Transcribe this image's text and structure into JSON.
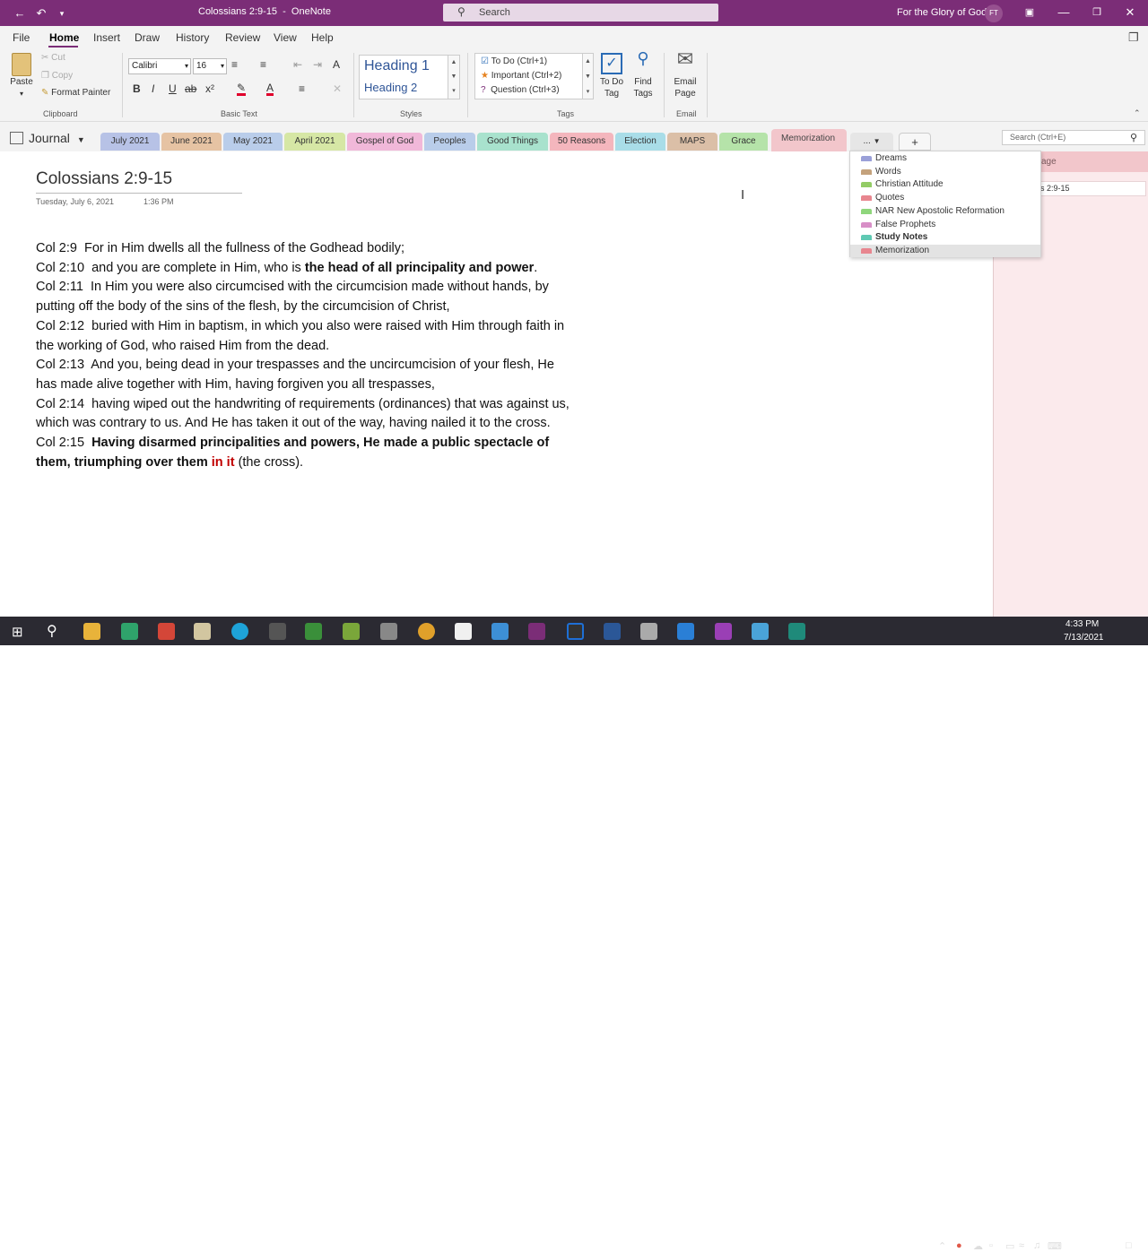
{
  "window": {
    "title": "Colossians 2:9-15  -  OneNote",
    "search_placeholder": "Search",
    "account_name": "For the Glory of God",
    "avatar_initials": "FT",
    "accent_color": "#7b2d77"
  },
  "menu": {
    "items": [
      "File",
      "Home",
      "Insert",
      "Draw",
      "History",
      "Review",
      "View",
      "Help"
    ],
    "active": "Home"
  },
  "ribbon": {
    "clipboard": {
      "paste": "Paste",
      "cut": "Cut",
      "copy": "Copy",
      "format_painter": "Format Painter",
      "label": "Clipboard"
    },
    "basic_text": {
      "font": "Calibri",
      "size": "16",
      "label": "Basic Text"
    },
    "styles": {
      "heading1": "Heading 1",
      "heading2": "Heading 2",
      "label": "Styles"
    },
    "tags": {
      "todo": "To Do (Ctrl+1)",
      "important": "Important (Ctrl+2)",
      "question": "Question (Ctrl+3)",
      "todo_tag": "To Do Tag",
      "find_tags": "Find Tags",
      "label": "Tags"
    },
    "email": {
      "email_page": "Email Page",
      "label": "Email"
    }
  },
  "notebook": {
    "name": "Journal"
  },
  "sections": [
    {
      "name": "July 2021",
      "color": "#b7c2e6"
    },
    {
      "name": "June 2021",
      "color": "#e6c3a3"
    },
    {
      "name": "May 2021",
      "color": "#b9cdea"
    },
    {
      "name": "April 2021",
      "color": "#d6e7a5"
    },
    {
      "name": "Gospel of God",
      "color": "#f1b8d9"
    },
    {
      "name": "Peoples",
      "color": "#b9cdea"
    },
    {
      "name": "Good Things",
      "color": "#a8e2cd"
    },
    {
      "name": "50 Reasons",
      "color": "#f4b6bd"
    },
    {
      "name": "Election",
      "color": "#a9dde8"
    },
    {
      "name": "MAPS",
      "color": "#dbbfa7"
    },
    {
      "name": "Grace",
      "color": "#b5e3a9"
    },
    {
      "name": "Memorization",
      "color": "#f2c6cb"
    }
  ],
  "more_sections_label": "...",
  "tab_search_placeholder": "Search (Ctrl+E)",
  "overflow_sections": [
    {
      "name": "Dreams",
      "color": "#9aa0d8"
    },
    {
      "name": "Words",
      "color": "#c4a27c"
    },
    {
      "name": "Christian Attitude",
      "color": "#93cc66"
    },
    {
      "name": "Quotes",
      "color": "#e8868f"
    },
    {
      "name": "NAR New Apostolic Reformation",
      "color": "#8fd67c"
    },
    {
      "name": "False Prophets",
      "color": "#d88fc7"
    },
    {
      "name": "Study Notes",
      "color": "#5fc9b3",
      "bold": true
    },
    {
      "name": "Memorization",
      "color": "#e8868f",
      "highlighted": true
    }
  ],
  "page": {
    "title": "Colossians 2:9-15",
    "date": "Tuesday, July 6, 2021",
    "time": "1:36 PM",
    "verses": [
      {
        "parts": [
          {
            "text": "Col 2:9  For in Him dwells all the fullness of the Godhead bodily;"
          }
        ]
      },
      {
        "parts": [
          {
            "text": "Col 2:10  and you are complete in Him, who is "
          },
          {
            "text": "the head of all principality and power",
            "bold": true
          },
          {
            "text": "."
          }
        ]
      },
      {
        "parts": [
          {
            "text": "Col 2:11  In Him you were also circumcised with the circumcision made without hands, by putting off the body of the sins of the flesh, by the circumcision of Christ,"
          }
        ]
      },
      {
        "parts": [
          {
            "text": "Col 2:12  buried with Him in baptism, in which you also were raised with Him through faith in the working of God, who raised Him from the dead."
          }
        ]
      },
      {
        "parts": [
          {
            "text": "Col 2:13  And you, being dead in your trespasses and the uncircumcision of your flesh, He has made alive together with Him, having forgiven you all trespasses,"
          }
        ]
      },
      {
        "parts": [
          {
            "text": "Col 2:14  having wiped out the handwriting of requirements (ordinances) that was against us, which was contrary to us. And He has taken it out of the way, having nailed it to the cross."
          }
        ]
      },
      {
        "parts": [
          {
            "text": "Col 2:15  "
          },
          {
            "text": "Having disarmed principalities and powers, He made a public spectacle of them, triumphing over them ",
            "bold": true
          },
          {
            "text": "in it",
            "bold": true,
            "color": "#c00000"
          },
          {
            "text": " (the cross)."
          }
        ]
      }
    ]
  },
  "pages_pane": {
    "header": "age",
    "current_page": "s 2:9-15"
  },
  "taskbar": {
    "time": "4:33 PM",
    "date": "7/13/2021"
  }
}
